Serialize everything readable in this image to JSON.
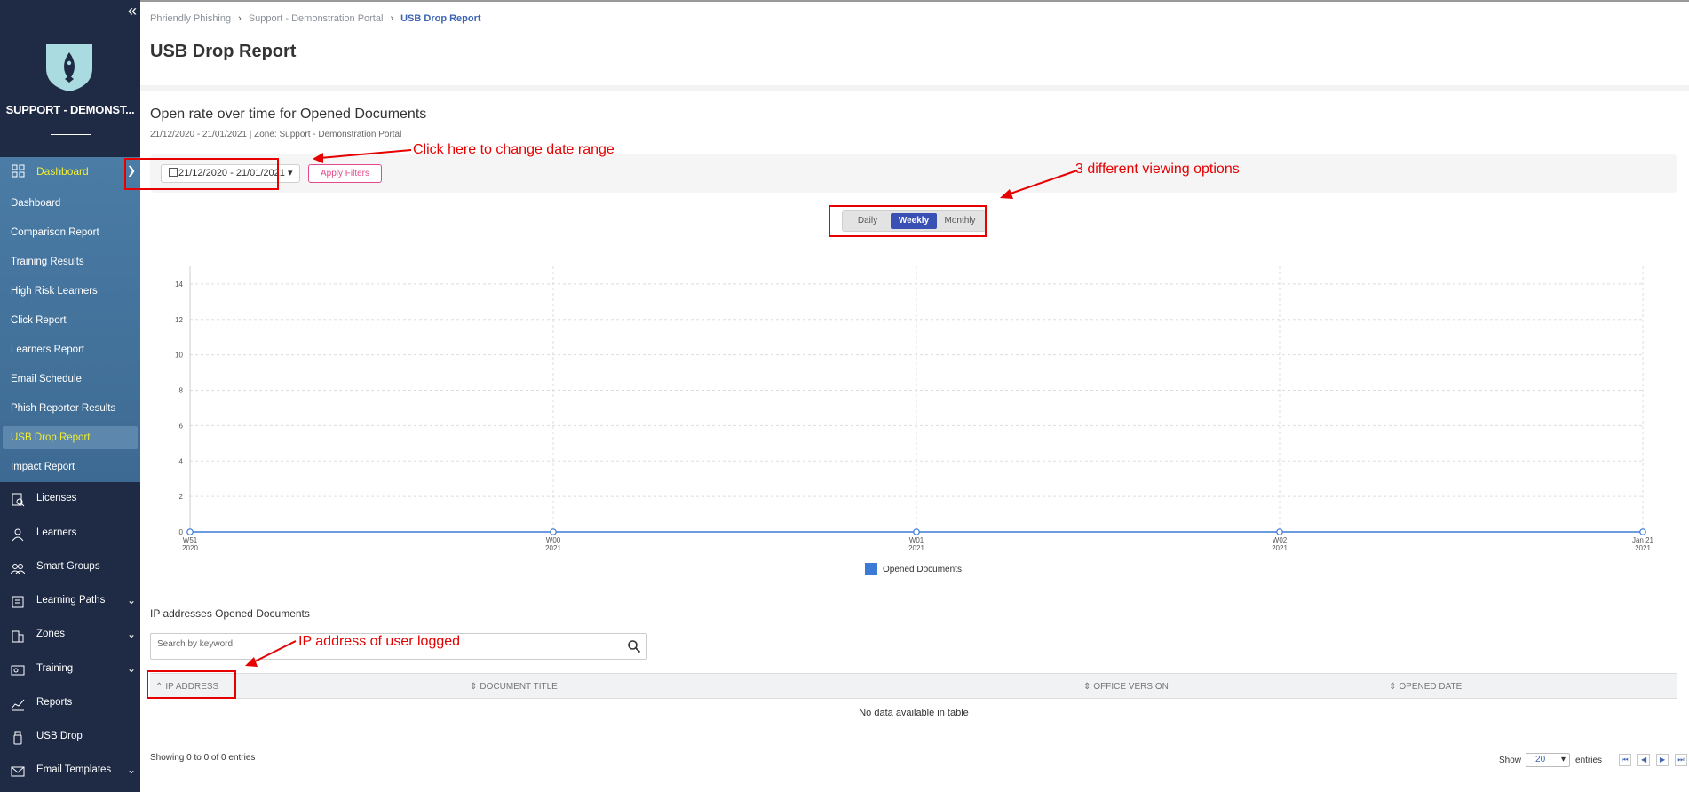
{
  "sidebar": {
    "org_name": "SUPPORT - DEMONST...",
    "dashboard_label": "Dashboard",
    "sub_items": [
      {
        "label": "Dashboard"
      },
      {
        "label": "Comparison Report"
      },
      {
        "label": "Training Results"
      },
      {
        "label": "High Risk Learners"
      },
      {
        "label": "Click Report"
      },
      {
        "label": "Learners Report"
      },
      {
        "label": "Email Schedule"
      },
      {
        "label": "Phish Reporter Results"
      },
      {
        "label": "USB Drop Report"
      },
      {
        "label": "Impact Report"
      }
    ],
    "nav_items": [
      {
        "label": "Licenses"
      },
      {
        "label": "Learners"
      },
      {
        "label": "Smart Groups"
      },
      {
        "label": "Learning Paths"
      },
      {
        "label": "Zones"
      },
      {
        "label": "Training"
      },
      {
        "label": "Reports"
      },
      {
        "label": "USB Drop"
      },
      {
        "label": "Email Templates"
      }
    ]
  },
  "breadcrumb": [
    "Phriendly Phishing",
    "Support - Demonstration Portal",
    "USB Drop Report"
  ],
  "page_title": "USB Drop Report",
  "section": {
    "title": "Open rate over time for Opened Documents",
    "subtitle": "21/12/2020 - 21/01/2021 | Zone: Support - Demonstration Portal"
  },
  "filters": {
    "date_range": "21/12/2020 - 21/01/2021",
    "apply_label": "Apply Filters"
  },
  "view_options": [
    "Daily",
    "Weekly",
    "Monthly"
  ],
  "selected_view": "Weekly",
  "chart_data": {
    "type": "line",
    "x": [
      "W51 2020",
      "W00 2021",
      "W01 2021",
      "W02 2021",
      "Jan 21 2021"
    ],
    "x_labels": [
      [
        "W51",
        "2020"
      ],
      [
        "W00",
        "2021"
      ],
      [
        "W01",
        "2021"
      ],
      [
        "W02",
        "2021"
      ],
      [
        "Jan 21",
        "2021"
      ]
    ],
    "series": [
      {
        "name": "Opened Documents",
        "values": [
          0,
          0,
          0,
          0,
          0
        ]
      }
    ],
    "yticks": [
      0,
      2,
      4,
      6,
      8,
      10,
      12,
      14
    ],
    "ylim": [
      0,
      15
    ],
    "grid": true,
    "legend": "bottom-center",
    "color": "#3d7ad6"
  },
  "table": {
    "title": "IP addresses Opened Documents",
    "search_placeholder": "Search by keyword",
    "columns": [
      "IP ADDRESS",
      "DOCUMENT TITLE",
      "OFFICE VERSION",
      "OPENED DATE"
    ],
    "empty_text": "No data available in table",
    "showing_text": "Showing 0 to 0 of 0 entries",
    "show_label": "Show",
    "page_size": "20",
    "entries_label": "entries"
  },
  "annotations": {
    "date_range": "Click here to change date range",
    "view_options": "3 different viewing options",
    "ip_address": "IP address of user logged"
  },
  "colors": {
    "sidebar_bg": "#1f2b45",
    "dashboard_section_bg": "#4a7ca6",
    "active_text": "#f1ee32",
    "accent": "#3950b5",
    "annotation": "#e60000"
  }
}
